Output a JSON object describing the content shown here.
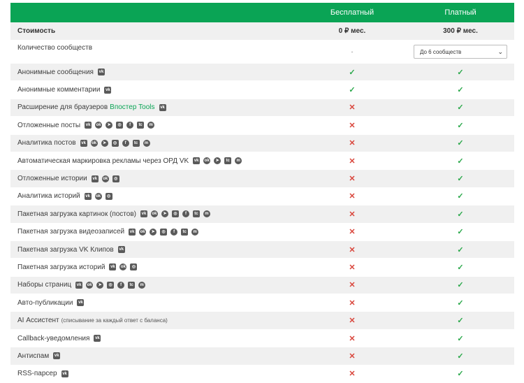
{
  "header": {
    "free": "Бесплатный",
    "paid": "Платный"
  },
  "price_row": {
    "label": "Стоимость",
    "free": "0 ₽ мес.",
    "paid": "300 ₽ мес."
  },
  "communities_row": {
    "label": "Количество сообществ",
    "free": "-",
    "select_value": "До 6 сообществ"
  },
  "rows": [
    {
      "label": "Анонимные сообщения",
      "icons": [
        "vk"
      ],
      "free": "✓",
      "paid": "✓"
    },
    {
      "label": "Анонимные комментарии",
      "icons": [
        "vk"
      ],
      "free": "✓",
      "paid": "✓"
    },
    {
      "label": "Расширение для браузеров",
      "link": "Впостер Tools",
      "icons": [
        "vk"
      ],
      "free": "✕",
      "paid": "✓"
    },
    {
      "label": "Отложенные посты",
      "icons": [
        "vk",
        "ok",
        "telegram",
        "instagram",
        "facebook",
        "tenchat",
        "max"
      ],
      "free": "✕",
      "paid": "✓"
    },
    {
      "label": "Аналитика постов",
      "icons": [
        "vk",
        "ok",
        "telegram",
        "instagram",
        "facebook",
        "tenchat",
        "max"
      ],
      "free": "✕",
      "paid": "✓"
    },
    {
      "label": "Автоматическая маркировка рекламы через ОРД VK",
      "icons": [
        "vk",
        "ok",
        "telegram",
        "tenchat",
        "max"
      ],
      "free": "✕",
      "paid": "✓"
    },
    {
      "label": "Отложенные истории",
      "icons": [
        "vk",
        "ok",
        "instagram"
      ],
      "free": "✕",
      "paid": "✓"
    },
    {
      "label": "Аналитика историй",
      "icons": [
        "vk",
        "ok",
        "instagram"
      ],
      "free": "✕",
      "paid": "✓"
    },
    {
      "label": "Пакетная загрузка картинок (постов)",
      "icons": [
        "vk",
        "ok",
        "telegram",
        "instagram",
        "facebook",
        "tenchat",
        "max"
      ],
      "free": "✕",
      "paid": "✓"
    },
    {
      "label": "Пакетная загрузка видеозаписей",
      "icons": [
        "vk",
        "ok",
        "telegram",
        "instagram",
        "facebook",
        "tenchat",
        "max"
      ],
      "free": "✕",
      "paid": "✓"
    },
    {
      "label": "Пакетная загрузка VK Клипов",
      "icons": [
        "vk"
      ],
      "free": "✕",
      "paid": "✓"
    },
    {
      "label": "Пакетная загрузка историй",
      "icons": [
        "vk",
        "ok",
        "instagram"
      ],
      "free": "✕",
      "paid": "✓"
    },
    {
      "label": "Наборы страниц",
      "icons": [
        "vk",
        "ok",
        "telegram",
        "instagram",
        "facebook",
        "tenchat",
        "max"
      ],
      "free": "✕",
      "paid": "✓"
    },
    {
      "label": "Авто-публикации",
      "icons": [
        "vk"
      ],
      "free": "✕",
      "paid": "✓"
    },
    {
      "label": "AI Ассистент",
      "note": "(списывание за каждый ответ с баланса)",
      "icons": [],
      "free": "✕",
      "paid": "✓"
    },
    {
      "label": "Callback-уведомления",
      "icons": [
        "vk"
      ],
      "free": "✕",
      "paid": "✓"
    },
    {
      "label": "Антиспам",
      "icons": [
        "vk"
      ],
      "free": "✕",
      "paid": "✓"
    },
    {
      "label": "RSS-парсер",
      "icons": [
        "vk"
      ],
      "free": "✕",
      "paid": "✓"
    }
  ]
}
